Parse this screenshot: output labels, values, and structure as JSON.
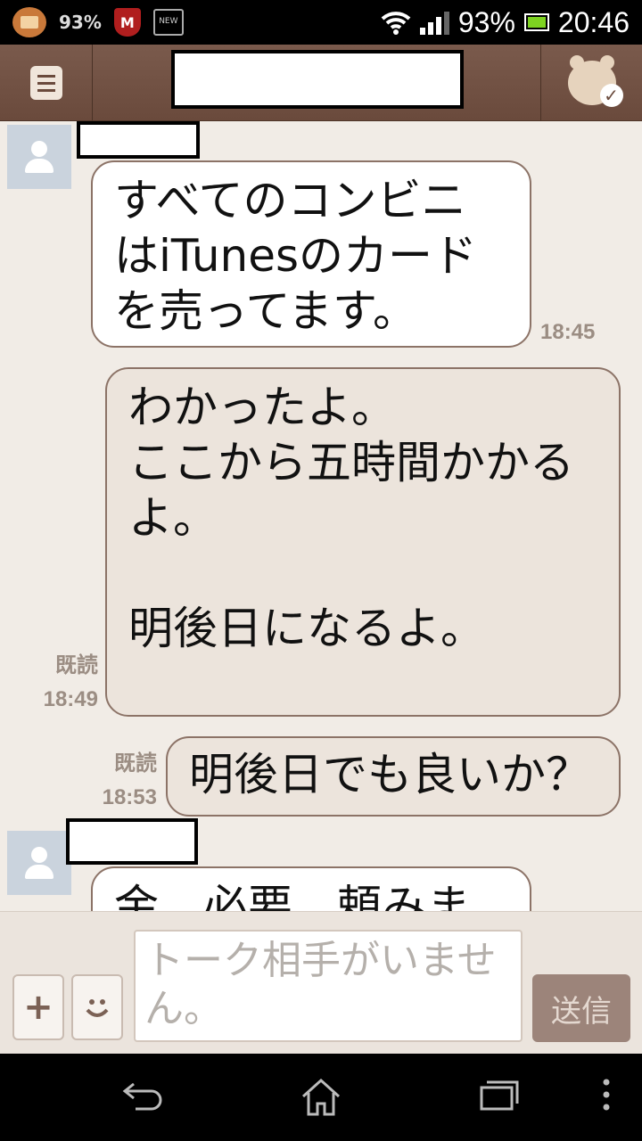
{
  "status_bar": {
    "notification_battery": "93%",
    "mcafee_letter": "M",
    "new_label": "NEW",
    "battery_percent": "93%",
    "time": "20:46"
  },
  "messages": [
    {
      "direction": "incoming",
      "text": "すべてのコンビニ\nはiTunesのカード\nを売ってます。",
      "time": "18:45"
    },
    {
      "direction": "outgoing",
      "text": "わかったよ。\nここから五時間かかる\nよ。\n\n明後日になるよ。",
      "read": "既読",
      "time": "18:49"
    },
    {
      "direction": "outgoing",
      "text": "明後日でも良いか？",
      "read": "既読",
      "time": "18:53"
    },
    {
      "direction": "incoming",
      "text": "金　必要　頼みま"
    }
  ],
  "input": {
    "placeholder": "トーク相手がいません。",
    "send_label": "送信"
  }
}
